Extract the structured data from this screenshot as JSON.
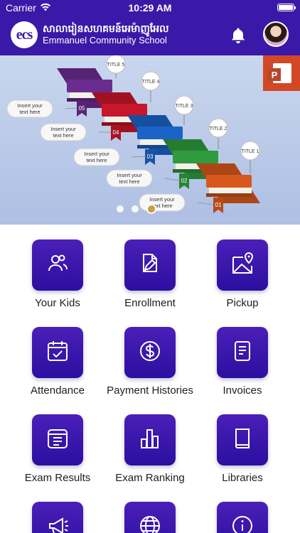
{
  "status_bar": {
    "carrier": "Carrier",
    "time": "10:29 AM",
    "battery_level": 1.0
  },
  "header": {
    "logo_text": "ecs",
    "school_name_khmer": "សាលារៀនសហគមន៍អេម៉ាញូអែល",
    "school_name": "Emmanuel Community School",
    "icons": [
      "bell-icon",
      "user-avatar"
    ]
  },
  "banner": {
    "slides_total": 3,
    "active_slide": 3,
    "steps": [
      {
        "number": "01",
        "title": "TITLE 1",
        "color": "#d7581c",
        "text": "Insert your text here"
      },
      {
        "number": "02",
        "title": "TITLE 2",
        "color": "#2e9b3d",
        "text": "Insert your text here"
      },
      {
        "number": "03",
        "title": "TITLE 3",
        "color": "#1c63c8",
        "text": "Insert your text here"
      },
      {
        "number": "04",
        "title": "TITLE 4",
        "color": "#c8162a",
        "text": "Insert your text here"
      },
      {
        "number": "05",
        "title": "TITLE 5",
        "color": "#6a2c8e",
        "text": "Insert your text here"
      }
    ],
    "app_icon": "powerpoint-icon",
    "app_icon_letter": "P"
  },
  "menu": [
    {
      "label": "Your Kids",
      "icon": "people-icon"
    },
    {
      "label": "Enrollment",
      "icon": "edit-document-icon"
    },
    {
      "label": "Pickup",
      "icon": "map-pin-icon"
    },
    {
      "label": "Attendance",
      "icon": "calendar-check-icon"
    },
    {
      "label": "Payment Histories",
      "icon": "dollar-icon"
    },
    {
      "label": "Invoices",
      "icon": "invoice-icon"
    },
    {
      "label": "Exam Results",
      "icon": "list-calendar-icon"
    },
    {
      "label": "Exam Ranking",
      "icon": "bar-chart-icon"
    },
    {
      "label": "Libraries",
      "icon": "book-icon"
    },
    {
      "label": "",
      "icon": "megaphone-icon"
    },
    {
      "label": "",
      "icon": "globe-icon"
    },
    {
      "label": "",
      "icon": "info-icon"
    }
  ],
  "colors": {
    "header_bg": "#3a19a8",
    "tile_bg": "#3512a8",
    "active_dot": "#c8962a"
  }
}
